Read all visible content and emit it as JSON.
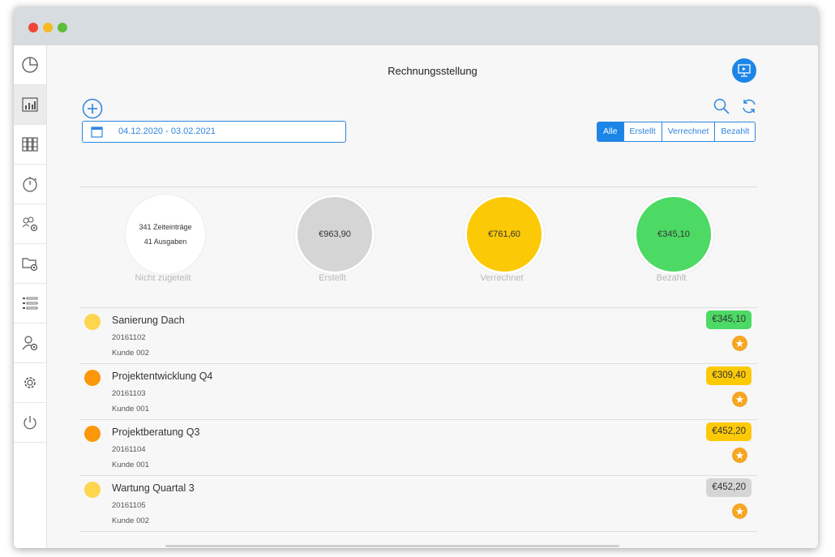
{
  "window": {
    "title": "Rechnungsstellung"
  },
  "sidebar": {
    "items": [
      {
        "icon": "pie-chart-icon"
      },
      {
        "icon": "bar-chart-icon",
        "active": true
      },
      {
        "icon": "binders-icon"
      },
      {
        "icon": "stopwatch-icon"
      },
      {
        "icon": "team-settings-icon"
      },
      {
        "icon": "folder-settings-icon"
      },
      {
        "icon": "list-icon"
      },
      {
        "icon": "user-settings-icon"
      },
      {
        "icon": "gear-icon"
      },
      {
        "icon": "power-icon"
      }
    ]
  },
  "toolbar": {
    "date_range": "04.12.2020 - 03.02.2021",
    "filters": [
      "Alle",
      "Erstellt",
      "Verrechnet",
      "Bezahlt"
    ],
    "selected_filter": "Alle"
  },
  "summary": [
    {
      "line1": "341 Zeiteinträge",
      "line2": "41 Ausgaben",
      "label": "Nicht zugeteilt",
      "color": "#ffffff"
    },
    {
      "value": "€963,90",
      "label": "Erstellt",
      "color": "#d5d5d5"
    },
    {
      "value": "€761,60",
      "label": "Verrechnet",
      "color": "#fcc907"
    },
    {
      "value": "€345,10",
      "label": "Bezahlt",
      "color": "#4cd964"
    }
  ],
  "invoices": [
    {
      "name": "Sanierung Dach",
      "number": "20161102",
      "client": "Kunde 002",
      "amount": "€345,10",
      "dot_color": "#fdd54f",
      "amount_color": "#4cd964"
    },
    {
      "name": "Projektentwicklung Q4",
      "number": "20161103",
      "client": "Kunde 001",
      "amount": "€309,40",
      "dot_color": "#fb9708",
      "amount_color": "#fcc907"
    },
    {
      "name": "Projektberatung Q3",
      "number": "20161104",
      "client": "Kunde 001",
      "amount": "€452,20",
      "dot_color": "#fb9708",
      "amount_color": "#fcc907"
    },
    {
      "name": "Wartung Quartal 3",
      "number": "20161105",
      "client": "Kunde 002",
      "amount": "€452,20",
      "dot_color": "#fdd54f",
      "amount_color": "#d5d5d5"
    }
  ]
}
